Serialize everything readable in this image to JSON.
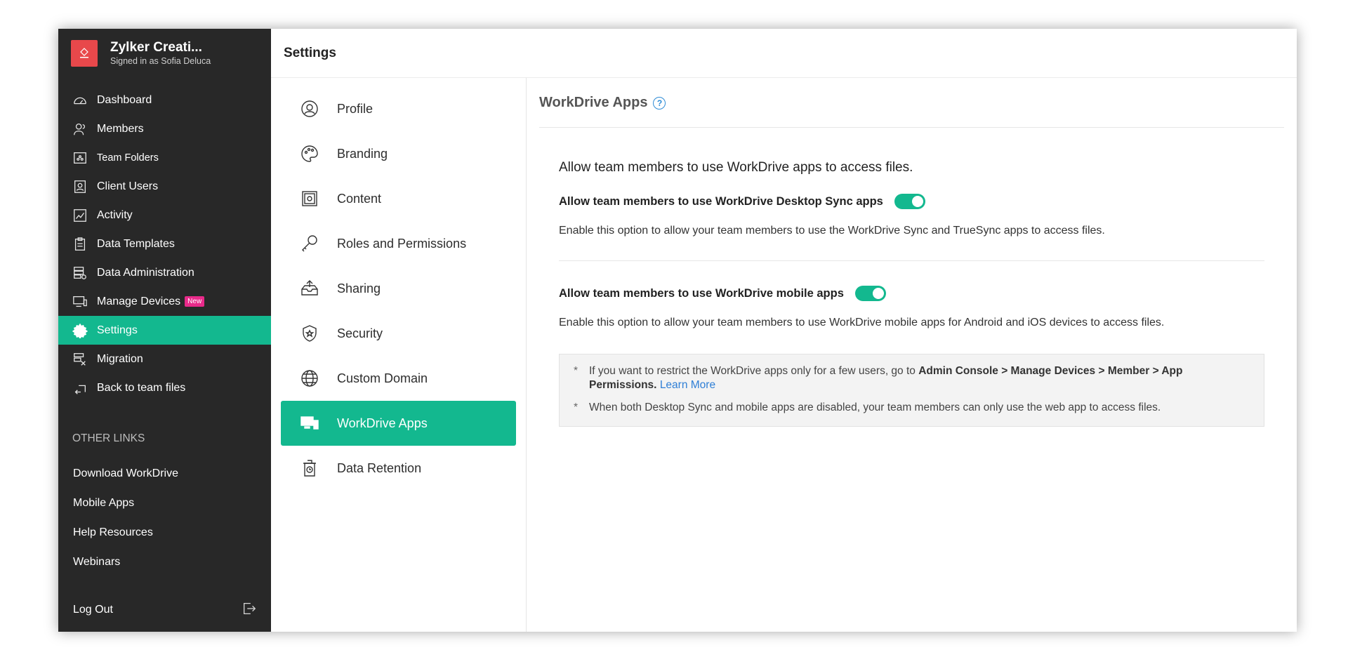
{
  "brand": {
    "name": "Zylker Creati...",
    "signed_in": "Signed in as Sofia Deluca"
  },
  "sidebar": {
    "items": [
      {
        "label": "Dashboard",
        "icon": "dashboard-icon"
      },
      {
        "label": "Members",
        "icon": "members-icon"
      },
      {
        "label": "Team Folders",
        "icon": "team-folders-icon"
      },
      {
        "label": "Client Users",
        "icon": "client-users-icon"
      },
      {
        "label": "Activity",
        "icon": "activity-icon"
      },
      {
        "label": "Data Templates",
        "icon": "data-templates-icon"
      },
      {
        "label": "Data Administration",
        "icon": "data-administration-icon"
      },
      {
        "label": "Manage Devices",
        "icon": "manage-devices-icon",
        "badge": "New"
      },
      {
        "label": "Settings",
        "icon": "settings-icon"
      },
      {
        "label": "Migration",
        "icon": "migration-icon"
      },
      {
        "label": "Back to team files",
        "icon": "back-icon"
      }
    ],
    "active_index": 8,
    "other_links_title": "OTHER LINKS",
    "other_links": [
      "Download WorkDrive",
      "Mobile Apps",
      "Help Resources",
      "Webinars"
    ],
    "logout": "Log Out"
  },
  "header": {
    "title": "Settings"
  },
  "settings_nav": {
    "items": [
      {
        "label": "Profile",
        "icon": "profile-icon"
      },
      {
        "label": "Branding",
        "icon": "palette-icon"
      },
      {
        "label": "Content",
        "icon": "vault-icon"
      },
      {
        "label": "Roles and Permissions",
        "icon": "key-icon"
      },
      {
        "label": "Sharing",
        "icon": "share-icon"
      },
      {
        "label": "Security",
        "icon": "shield-icon"
      },
      {
        "label": "Custom Domain",
        "icon": "globe-icon"
      },
      {
        "label": "WorkDrive Apps",
        "icon": "devices-icon"
      },
      {
        "label": "Data Retention",
        "icon": "retention-icon"
      }
    ],
    "active_index": 7
  },
  "panel": {
    "title": "WorkDrive Apps",
    "heading": "Allow team members to use WorkDrive apps to access files.",
    "desktop_label": "Allow team members to use WorkDrive Desktop Sync apps",
    "desktop_enabled": true,
    "desktop_desc": "Enable this option to allow your team members to use the WorkDrive Sync and TrueSync apps to access files.",
    "mobile_label": "Allow team members to use WorkDrive mobile apps",
    "mobile_enabled": true,
    "mobile_desc": "Enable this option to allow your team members to use WorkDrive mobile apps for Android and iOS devices to access files.",
    "note_star": "*",
    "note1_prefix": "If you want to restrict the WorkDrive apps only for a few users, go to ",
    "note1_path": "Admin Console > Manage Devices > Member > App Permissions.",
    "note1_link": "Learn More",
    "note2": "When both Desktop Sync and mobile apps are disabled, your team members can only use the web app to access files."
  },
  "colors": {
    "accent": "#13b88f",
    "sidebar_bg": "#282828",
    "badge": "#e82a8a",
    "link": "#2f7fd6"
  }
}
